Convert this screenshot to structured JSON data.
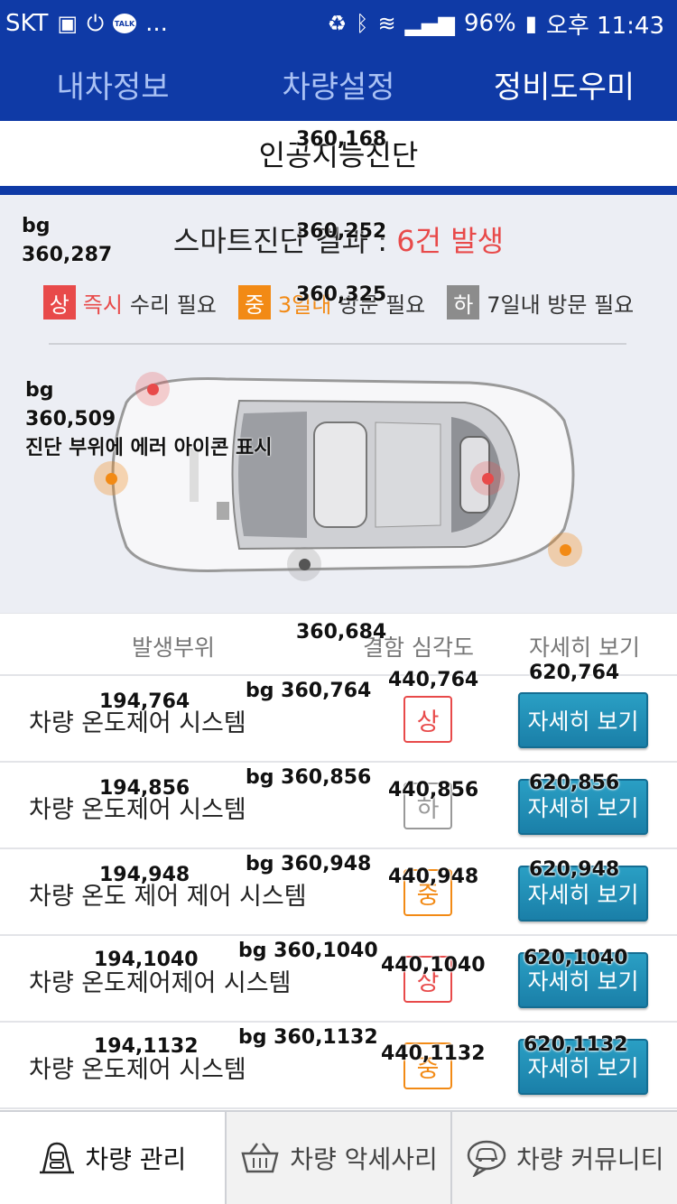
{
  "status_bar": {
    "carrier": "SKT",
    "more": "...",
    "battery": "96%",
    "time": "오후 11:43",
    "talk": "TALK"
  },
  "top_tabs": [
    {
      "label": "내차정보"
    },
    {
      "label": "차량설정"
    },
    {
      "label": "정비도우미",
      "active": true
    }
  ],
  "subheader": {
    "title": "인공지능진단",
    "overlay": "360,168"
  },
  "diagnosis": {
    "bg_label": "bg",
    "bg_coords": "360,287",
    "result_prefix": "스마트진단 결과 :",
    "result_count": "6건 발생",
    "result_overlay": "360,252",
    "legend_overlay": "360,325",
    "legend": [
      {
        "badge": "상",
        "highlight": "즉시",
        "text": "수리 필요"
      },
      {
        "badge": "중",
        "highlight": "3일내",
        "text": "방문 필요"
      },
      {
        "badge": "하",
        "highlight": "",
        "text": "7일내 방문 필요"
      }
    ],
    "car_bg_label": "bg",
    "car_bg_coords": "360,509",
    "car_caption": "진단 부위에 에러 아이콘 표시",
    "markers": [
      {
        "severity": "high"
      },
      {
        "severity": "mid"
      },
      {
        "severity": "high"
      },
      {
        "severity": "low"
      },
      {
        "severity": "mid"
      }
    ]
  },
  "table": {
    "headers": {
      "part": "발생부위",
      "severity": "결함 심각도",
      "detail": "자세히 보기"
    },
    "header_overlay": "360,684",
    "rows": [
      {
        "name": "차량 온도제어 시스템",
        "severity": "상",
        "level": "high",
        "button": "자세히 보기",
        "ov_name": "194,764",
        "ov_bg": "bg 360,764",
        "ov_sev": "440,764",
        "ov_btn": "620,764"
      },
      {
        "name": "차량 온도제어 시스템",
        "severity": "하",
        "level": "low",
        "button": "자세히 보기",
        "ov_name": "194,856",
        "ov_bg": "bg 360,856",
        "ov_sev": "440,856",
        "ov_btn": "620,856"
      },
      {
        "name": "차량 온도 제어 제어 시스템",
        "severity": "중",
        "level": "mid",
        "button": "자세히 보기",
        "ov_name": "194,948",
        "ov_bg": "bg 360,948",
        "ov_sev": "440,948",
        "ov_btn": "620,948"
      },
      {
        "name": "차량 온도제어제어 시스템",
        "severity": "상",
        "level": "high",
        "button": "자세히 보기",
        "ov_name": "194,1040",
        "ov_bg": "bg 360,1040",
        "ov_sev": "440,1040",
        "ov_btn": "620,1040"
      },
      {
        "name": "차량 온도제어 시스템",
        "severity": "중",
        "level": "mid",
        "button": "자세히 보기",
        "ov_name": "194,1132",
        "ov_bg": "bg 360,1132",
        "ov_sev": "440,1132",
        "ov_btn": "620,1132"
      }
    ]
  },
  "bottom_nav": [
    {
      "label": "차량 관리",
      "icon": "car-management-icon"
    },
    {
      "label": "차량 악세사리",
      "icon": "basket-icon"
    },
    {
      "label": "차량 커뮤니티",
      "icon": "car-chat-icon"
    }
  ],
  "colors": {
    "brand_blue": "#0f3aa6",
    "high": "#e84a4a",
    "mid": "#f28a15",
    "low": "#8c8c8c",
    "button": "#1a7fa8"
  }
}
